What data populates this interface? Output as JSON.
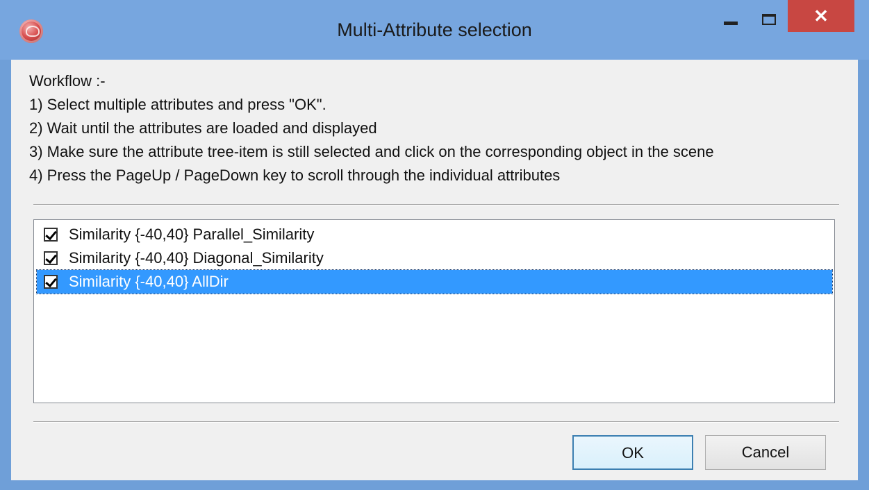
{
  "window": {
    "title": "Multi-Attribute selection",
    "close_glyph": "✕"
  },
  "workflow": {
    "heading": "Workflow :-",
    "steps": [
      "1) Select multiple attributes and press \"OK\".",
      "2) Wait until the attributes are loaded and displayed",
      "3) Make sure the attribute tree-item is still selected and click on the corresponding object in the scene",
      "4) Press the PageUp / PageDown key to scroll through the individual attributes"
    ]
  },
  "attributes": [
    {
      "label": "Similarity {-40,40} Parallel_Similarity",
      "checked": true,
      "selected": false
    },
    {
      "label": "Similarity {-40,40} Diagonal_Similarity",
      "checked": true,
      "selected": false
    },
    {
      "label": "Similarity {-40,40} AllDir",
      "checked": true,
      "selected": true
    }
  ],
  "buttons": {
    "ok": "OK",
    "cancel": "Cancel"
  },
  "colors": {
    "titlebar": "#77a6df",
    "close": "#c84742",
    "selection": "#3399ff"
  },
  "icons": {
    "app": "app-icon",
    "minimize": "minimize-icon",
    "maximize": "maximize-icon",
    "close": "close-icon",
    "checkbox": "checkmark-icon"
  }
}
